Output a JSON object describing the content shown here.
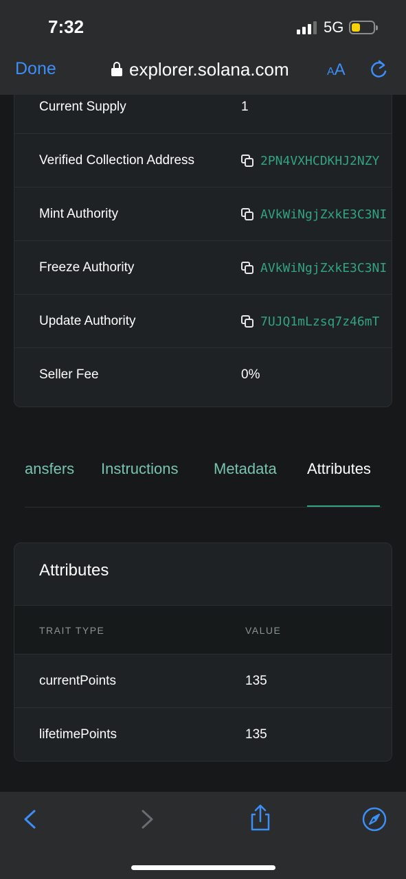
{
  "status": {
    "time": "7:32",
    "network": "5G"
  },
  "browser": {
    "done_label": "Done",
    "url": "explorer.solana.com",
    "aa_small": "A",
    "aa_large": "A"
  },
  "details": [
    {
      "label": "Current Supply",
      "value": "1"
    },
    {
      "label": "Verified Collection Address",
      "address": "2PN4VXHCDKHJ2NZY"
    },
    {
      "label": "Mint Authority",
      "address": "AVkWiNgjZxkE3C3NI"
    },
    {
      "label": "Freeze Authority",
      "address": "AVkWiNgjZxkE3C3NI"
    },
    {
      "label": "Update Authority",
      "address": "7UJQ1mLzsq7z46mT"
    },
    {
      "label": "Seller Fee",
      "value": "0%"
    }
  ],
  "tabs": [
    {
      "label": "ansfers"
    },
    {
      "label": "Instructions"
    },
    {
      "label": "Metadata"
    },
    {
      "label": "Attributes"
    }
  ],
  "attributes": {
    "title": "Attributes",
    "headers": {
      "trait": "TRAIT TYPE",
      "value": "VALUE"
    },
    "rows": [
      {
        "trait": "currentPoints",
        "value": "135"
      },
      {
        "trait": "lifetimePoints",
        "value": "135"
      }
    ]
  },
  "colors": {
    "accent_blue": "#3d8ef7",
    "accent_green": "#33a382",
    "tab_inactive": "#79c4ae",
    "background": "#161819",
    "card": "#1e2224"
  },
  "icons": [
    "lock-icon",
    "refresh-icon",
    "copy-icon",
    "back-icon",
    "forward-icon",
    "share-icon",
    "compass-icon"
  ]
}
